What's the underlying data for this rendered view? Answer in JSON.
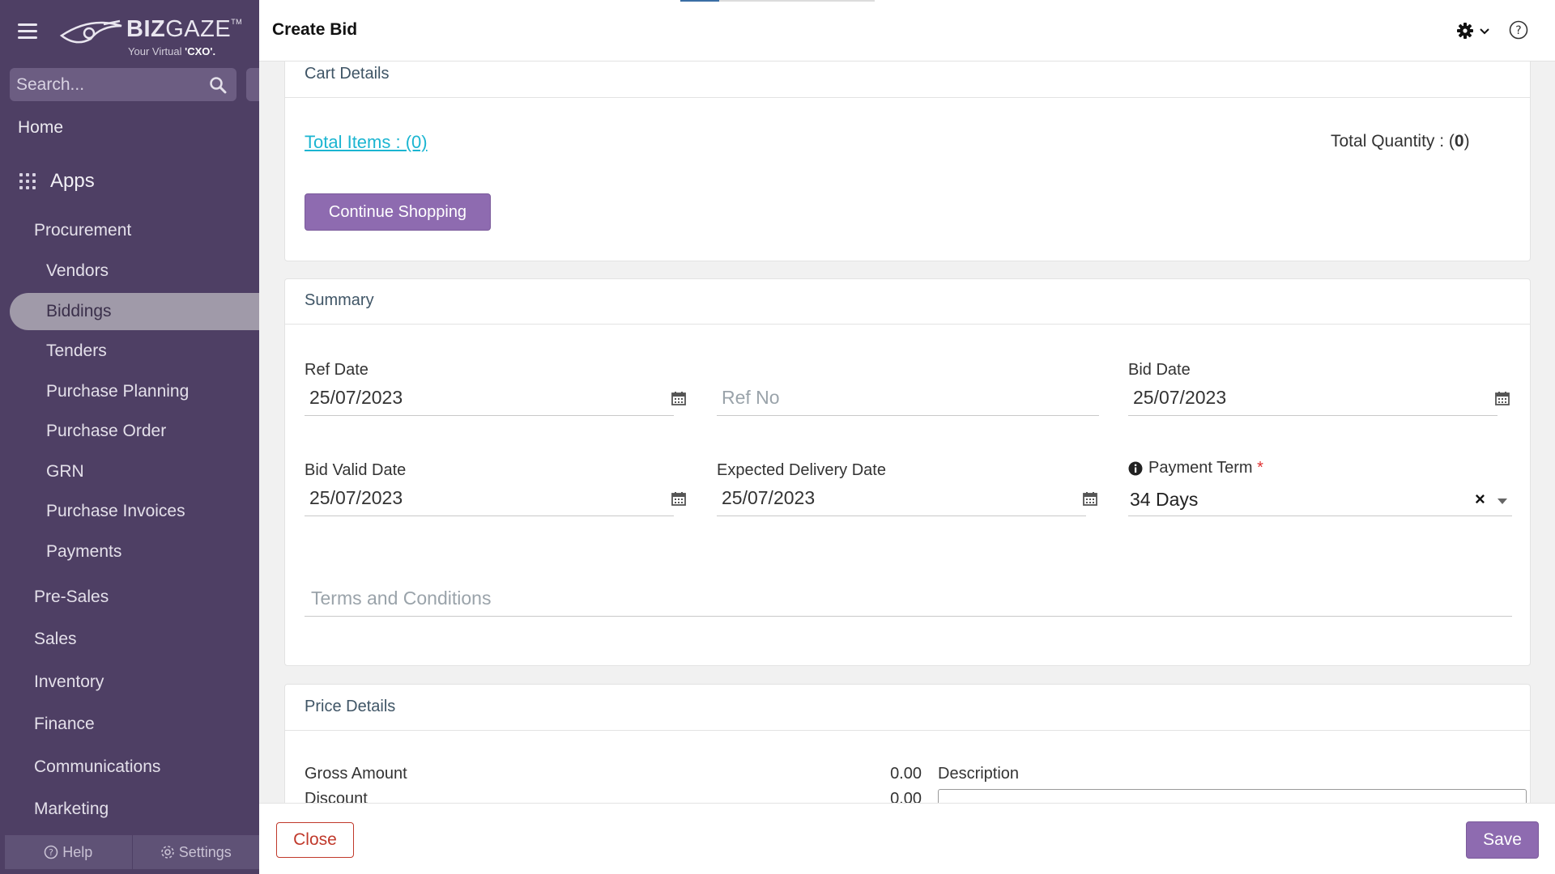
{
  "sidebar": {
    "logo": {
      "brand_bold": "BIZ",
      "brand_light": "GAZE",
      "trademark": "TM",
      "tagline_prefix": "Your Virtual ",
      "tagline_bold": "'CXO'."
    },
    "search_placeholder": "Search...",
    "home": "Home",
    "apps": "Apps",
    "procurement": "Procurement",
    "procurement_items": [
      "Vendors",
      "Biddings",
      "Tenders",
      "Purchase Planning",
      "Purchase Order",
      "GRN",
      "Purchase Invoices",
      "Payments"
    ],
    "active_item": "Biddings",
    "sections": [
      "Pre-Sales",
      "Sales",
      "Inventory",
      "Finance",
      "Communications",
      "Marketing"
    ],
    "bottom": {
      "help": "Help",
      "settings": "Settings"
    }
  },
  "header": {
    "title": "Create Bid"
  },
  "cart": {
    "title": "Cart Details",
    "total_items": "Total Items : (0)",
    "total_quantity_label": "Total Quantity : (",
    "total_quantity_value": "0",
    "total_quantity_suffix": ")",
    "continue_button": "Continue Shopping"
  },
  "summary": {
    "title": "Summary",
    "ref_date": {
      "label": "Ref Date",
      "value": "25/07/2023"
    },
    "ref_no": {
      "placeholder": "Ref No",
      "value": ""
    },
    "bid_date": {
      "label": "Bid Date",
      "value": "25/07/2023"
    },
    "bid_valid_date": {
      "label": "Bid Valid Date",
      "value": "25/07/2023"
    },
    "expected_delivery_date": {
      "label": "Expected Delivery Date",
      "value": "25/07/2023"
    },
    "payment_term": {
      "label": "Payment Term",
      "required_mark": "*",
      "value": "34 Days",
      "clear": "×"
    },
    "terms": {
      "placeholder": "Terms and Conditions",
      "value": ""
    }
  },
  "price": {
    "title": "Price Details",
    "gross_amount": {
      "label": "Gross Amount",
      "value": "0.00"
    },
    "discount": {
      "label": "Discount",
      "value": "0.00"
    },
    "description_label": "Description"
  },
  "footer": {
    "close": "Close",
    "save": "Save"
  },
  "colors": {
    "sidebar_bg": "#4e3f64",
    "accent": "#8e6bb0",
    "link": "#1bb5d1",
    "danger": "#c0392b"
  }
}
